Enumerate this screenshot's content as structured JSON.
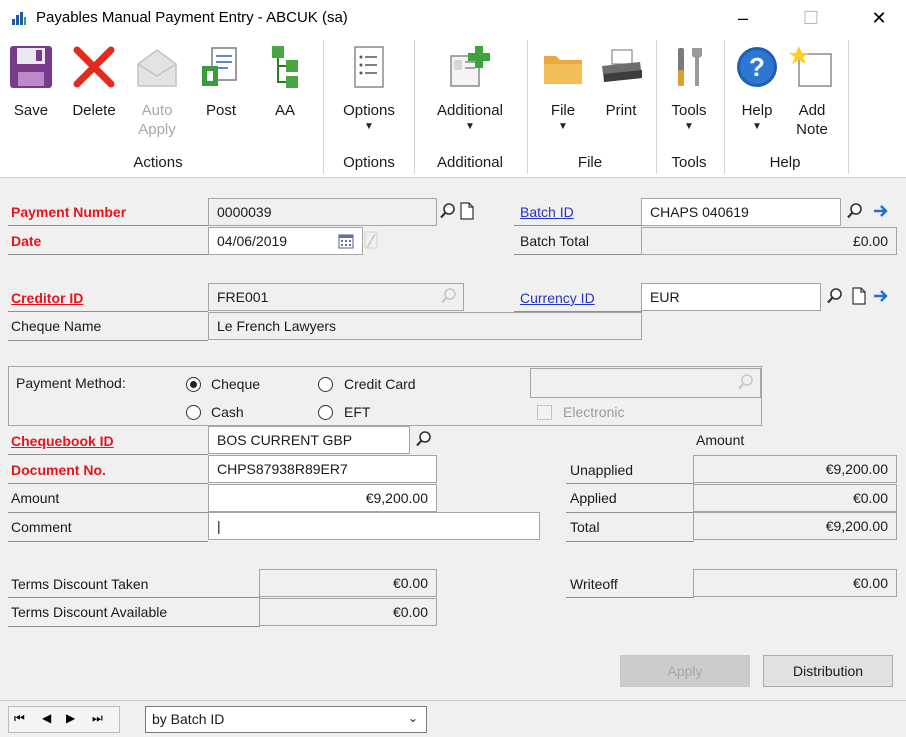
{
  "window": {
    "title": "Payables Manual Payment Entry  -  ABCUK (sa)",
    "minimize": "–",
    "maximize": "☐",
    "close": "✕"
  },
  "ribbon": {
    "save": "Save",
    "delete": "Delete",
    "auto_apply_1": "Auto",
    "auto_apply_2": "Apply",
    "post": "Post",
    "aa": "AA",
    "options": "Options",
    "additional": "Additional",
    "file": "File",
    "print": "Print",
    "tools": "Tools",
    "help": "Help",
    "add_note_1": "Add",
    "add_note_2": "Note",
    "groups": {
      "actions": "Actions",
      "options": "Options",
      "additional": "Additional",
      "file": "File",
      "tools": "Tools",
      "help": "Help"
    }
  },
  "form": {
    "payment_number_label": "Payment Number",
    "payment_number": "0000039",
    "date_label": "Date",
    "date": "04/06/2019",
    "batch_id_label": "Batch ID",
    "batch_id": "CHAPS 040619",
    "batch_total_label": "Batch Total",
    "batch_total": "£0.00",
    "creditor_id_label": "Creditor ID",
    "creditor_id": "FRE001",
    "cheque_name_label": "Cheque Name",
    "cheque_name": "Le French Lawyers",
    "currency_id_label": "Currency ID",
    "currency_id": "EUR",
    "payment_method_label": "Payment Method:",
    "pm_cheque": "Cheque",
    "pm_credit_card": "Credit Card",
    "pm_cash": "Cash",
    "pm_eft": "EFT",
    "selected_method": "Cheque",
    "electronic_label": "Electronic",
    "chequebook_id_label": "Chequebook ID",
    "chequebook_id": "BOS CURRENT GBP",
    "document_no_label": "Document No.",
    "document_no": "CHPS87938R89ER7",
    "amount_label": "Amount",
    "amount": "€9,200.00",
    "comment_label": "Comment",
    "comment": "|",
    "terms_taken_label": "Terms Discount Taken",
    "terms_taken": "€0.00",
    "terms_available_label": "Terms Discount Available",
    "terms_available": "€0.00",
    "amount_header": "Amount",
    "unapplied_label": "Unapplied",
    "unapplied": "€9,200.00",
    "applied_label": "Applied",
    "applied": "€0.00",
    "total_label": "Total",
    "total": "€9,200.00",
    "writeoff_label": "Writeoff",
    "writeoff": "€0.00",
    "apply_button": "Apply",
    "distribution_button": "Distribution"
  },
  "bottom": {
    "first": "⏮",
    "prev": "◀",
    "next": "▶",
    "last": "⏭",
    "sort_value": "by Batch ID"
  }
}
